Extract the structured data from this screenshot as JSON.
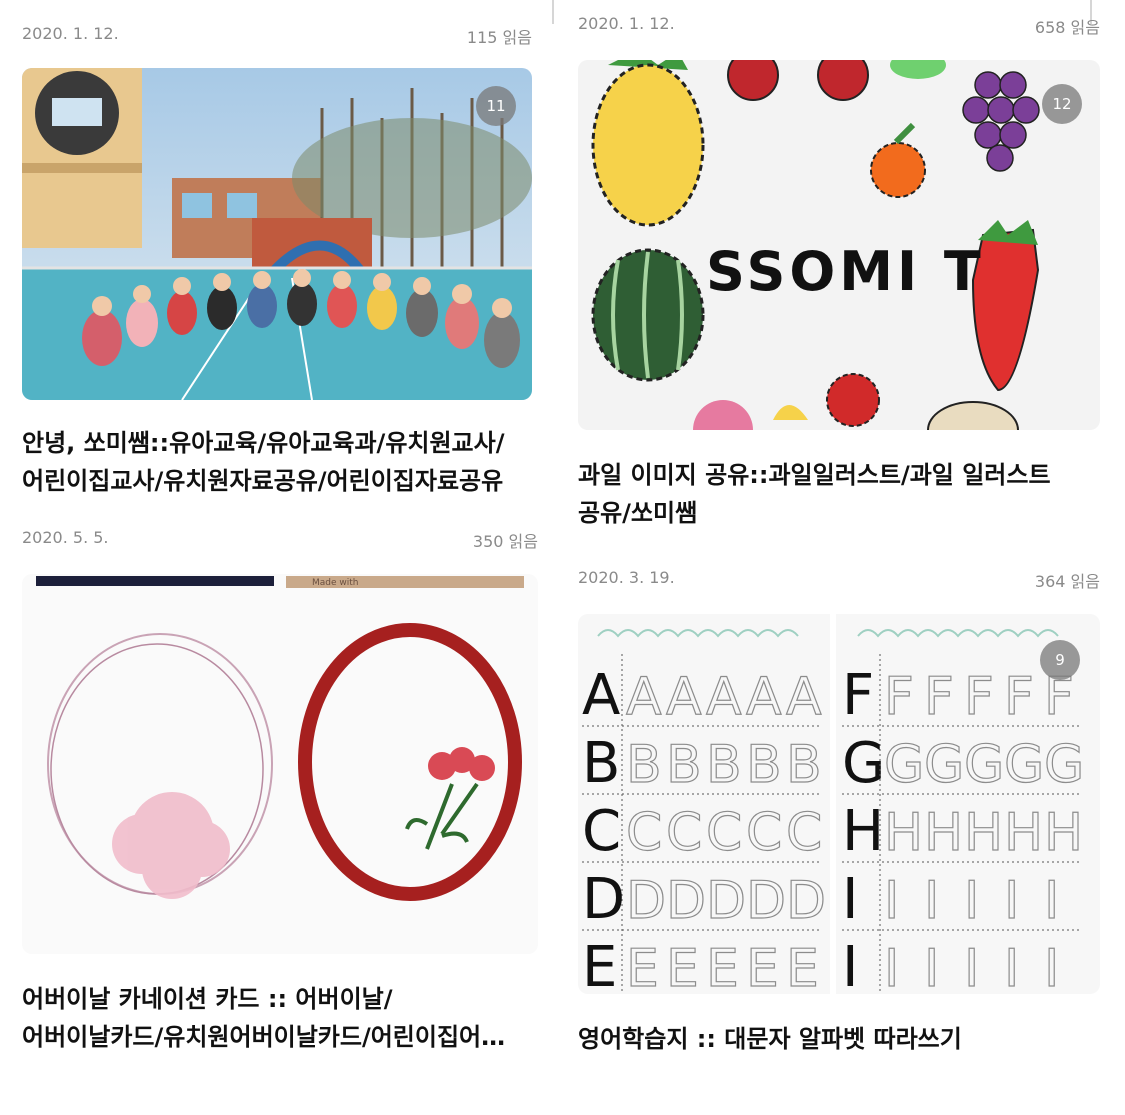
{
  "posts": [
    {
      "date": "2020. 1. 12.",
      "reads": "115 읽음",
      "image_count": "11",
      "title_line1": "안녕, 쏘미쌤::유아교육/유아교육과/유치원교사/",
      "title_line2": "어린이집교사/유치원자료공유/어린이집자료공유"
    },
    {
      "date": "2020. 1. 12.",
      "reads": "658 읽음",
      "image_count": "12",
      "image_text": "SSOMI T",
      "title_line1": "과일 이미지 공유::과일일러스트/과일 일러스트",
      "title_line2": "공유/쏘미쌤"
    },
    {
      "date": "2020. 5. 5.",
      "reads": "350 읽음",
      "image_text": "Made with",
      "title_line1": "어버이날 카네이션 카드 :: 어버이날/",
      "title_line2": "어버이날카드/유치원어버이날카드/어린이집어…"
    },
    {
      "date": "2020. 3. 19.",
      "reads": "364 읽음",
      "image_count": "9",
      "worksheet_left": [
        "A",
        "B",
        "C",
        "D",
        "E"
      ],
      "worksheet_right": [
        "F",
        "G",
        "H",
        "I",
        "I"
      ],
      "title_line1": "영어학습지 :: 대문자 알파벳 따라쓰기"
    }
  ]
}
